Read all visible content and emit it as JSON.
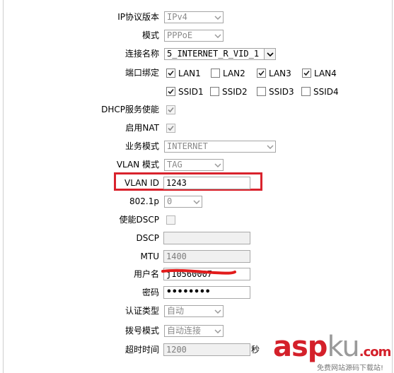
{
  "form": {
    "ip_version": {
      "label": "IP协议版本",
      "value": "IPv4"
    },
    "mode": {
      "label": "模式",
      "value": "PPPoE"
    },
    "connection_name": {
      "label": "连接名称",
      "value": "5_INTERNET_R_VID_1"
    },
    "port_binding": {
      "label": "端口绑定",
      "ports": [
        {
          "name": "LAN1",
          "checked": true
        },
        {
          "name": "LAN2",
          "checked": false
        },
        {
          "name": "LAN3",
          "checked": true
        },
        {
          "name": "LAN4",
          "checked": true
        },
        {
          "name": "SSID1",
          "checked": true
        },
        {
          "name": "SSID2",
          "checked": false
        },
        {
          "name": "SSID3",
          "checked": false
        },
        {
          "name": "SSID4",
          "checked": false
        }
      ]
    },
    "dhcp_service": {
      "label": "DHCP服务使能",
      "checked": true
    },
    "enable_nat": {
      "label": "启用NAT",
      "checked": true
    },
    "service_mode": {
      "label": "业务模式",
      "value": "INTERNET"
    },
    "vlan_mode": {
      "label": "VLAN 模式",
      "value": "TAG"
    },
    "vlan_id": {
      "label": "VLAN ID",
      "value": "1243"
    },
    "priority_8021p": {
      "label": "802.1p",
      "value": "0"
    },
    "enable_dscp": {
      "label": "使能DSCP",
      "checked": false
    },
    "dscp": {
      "label": "DSCP",
      "value": ""
    },
    "mtu": {
      "label": "MTU",
      "value": "1400"
    },
    "username": {
      "label": "用户名",
      "value": "j10560007"
    },
    "password": {
      "label": "密码",
      "value": "••••••••"
    },
    "auth_type": {
      "label": "认证类型",
      "value": "自动"
    },
    "dial_mode": {
      "label": "拨号模式",
      "value": "自动连接"
    },
    "timeout": {
      "label": "超时时间",
      "value": "1200",
      "unit": "秒"
    }
  },
  "watermark": {
    "brand_a": "asp",
    "brand_b": "ku",
    "brand_c": ".com",
    "subtitle": "免费网站源码下载站!"
  },
  "colors": {
    "highlight": "#d9232d",
    "watermark_red": "#d4202a",
    "disabled_text": "#8a8a8a"
  }
}
